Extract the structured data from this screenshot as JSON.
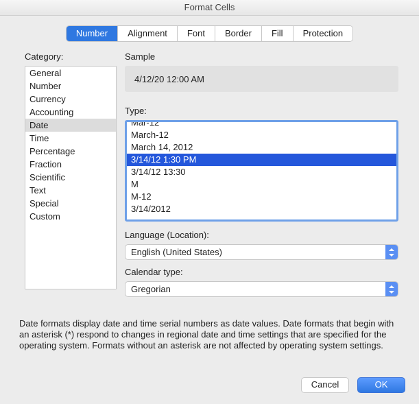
{
  "window": {
    "title": "Format Cells"
  },
  "tabs": {
    "items": [
      {
        "label": "Number",
        "selected": true
      },
      {
        "label": "Alignment",
        "selected": false
      },
      {
        "label": "Font",
        "selected": false
      },
      {
        "label": "Border",
        "selected": false
      },
      {
        "label": "Fill",
        "selected": false
      },
      {
        "label": "Protection",
        "selected": false
      }
    ]
  },
  "category": {
    "label": "Category:",
    "items": [
      {
        "label": "General",
        "selected": false
      },
      {
        "label": "Number",
        "selected": false
      },
      {
        "label": "Currency",
        "selected": false
      },
      {
        "label": "Accounting",
        "selected": false
      },
      {
        "label": "Date",
        "selected": true
      },
      {
        "label": "Time",
        "selected": false
      },
      {
        "label": "Percentage",
        "selected": false
      },
      {
        "label": "Fraction",
        "selected": false
      },
      {
        "label": "Scientific",
        "selected": false
      },
      {
        "label": "Text",
        "selected": false
      },
      {
        "label": "Special",
        "selected": false
      },
      {
        "label": "Custom",
        "selected": false
      }
    ]
  },
  "sample": {
    "label": "Sample",
    "value": "4/12/20 12:00 AM"
  },
  "type": {
    "label": "Type:",
    "items": [
      {
        "label": "Mar-12",
        "selected": false
      },
      {
        "label": "March-12",
        "selected": false
      },
      {
        "label": "March 14, 2012",
        "selected": false
      },
      {
        "label": "3/14/12 1:30 PM",
        "selected": true
      },
      {
        "label": "3/14/12 13:30",
        "selected": false
      },
      {
        "label": "M",
        "selected": false
      },
      {
        "label": "M-12",
        "selected": false
      },
      {
        "label": "3/14/2012",
        "selected": false
      }
    ]
  },
  "language": {
    "label": "Language (Location):",
    "value": "English (United States)"
  },
  "calendar": {
    "label": "Calendar type:",
    "value": "Gregorian"
  },
  "description": "Date formats display date and time serial numbers as date values.  Date formats that begin with an asterisk (*) respond to changes in regional date and time settings that are specified for the operating system. Formats without an asterisk are not affected by operating system settings.",
  "buttons": {
    "cancel": "Cancel",
    "ok": "OK"
  }
}
